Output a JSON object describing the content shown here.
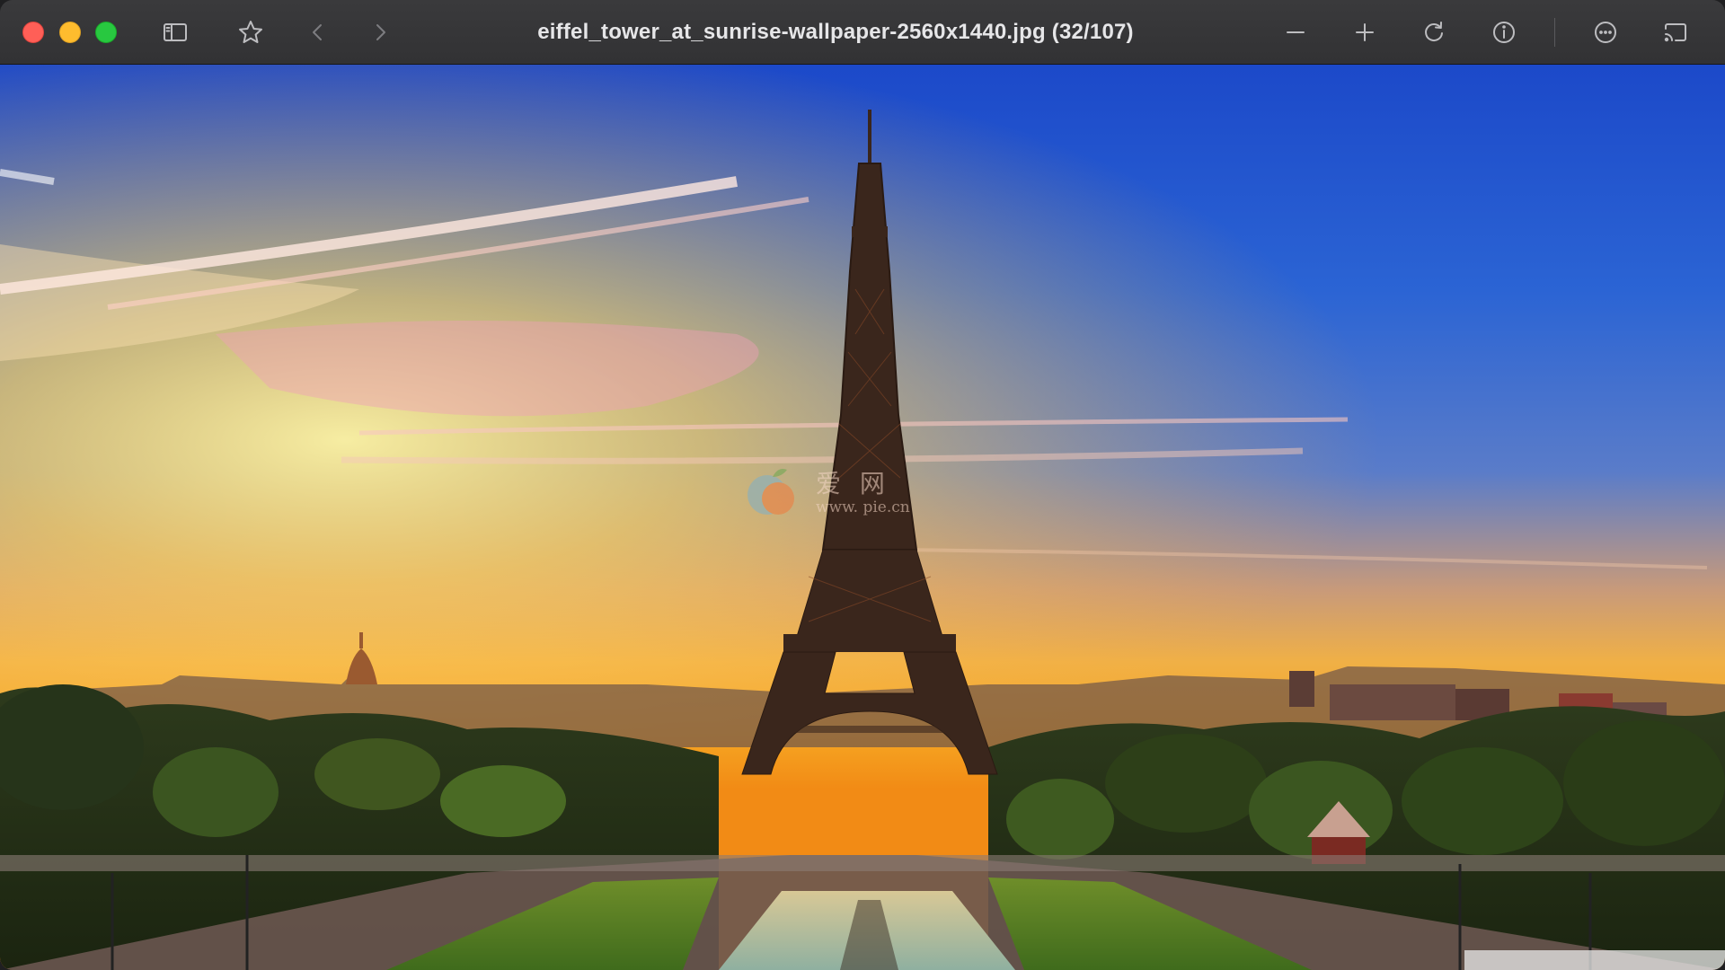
{
  "window": {
    "title": "eiffel_tower_at_sunrise-wallpaper-2560x1440.jpg (32/107)"
  },
  "toolbar": {
    "icons": {
      "sidebar": "sidebar-icon",
      "favorite": "star-icon",
      "previous": "chevron-left-icon",
      "next": "chevron-right-icon",
      "zoom_out": "minus-icon",
      "zoom_in": "plus-icon",
      "rotate": "rotate-icon",
      "info": "info-icon",
      "more": "ellipsis-icon",
      "cast": "cast-icon"
    }
  },
  "image": {
    "subject": "Eiffel Tower at sunrise",
    "watermark_text": "爱 网",
    "watermark_url": "www.          pie.cn"
  },
  "colors": {
    "close": "#ff5f57",
    "minimize": "#febc2e",
    "maximize": "#28c840",
    "toolbar": "#353537"
  }
}
